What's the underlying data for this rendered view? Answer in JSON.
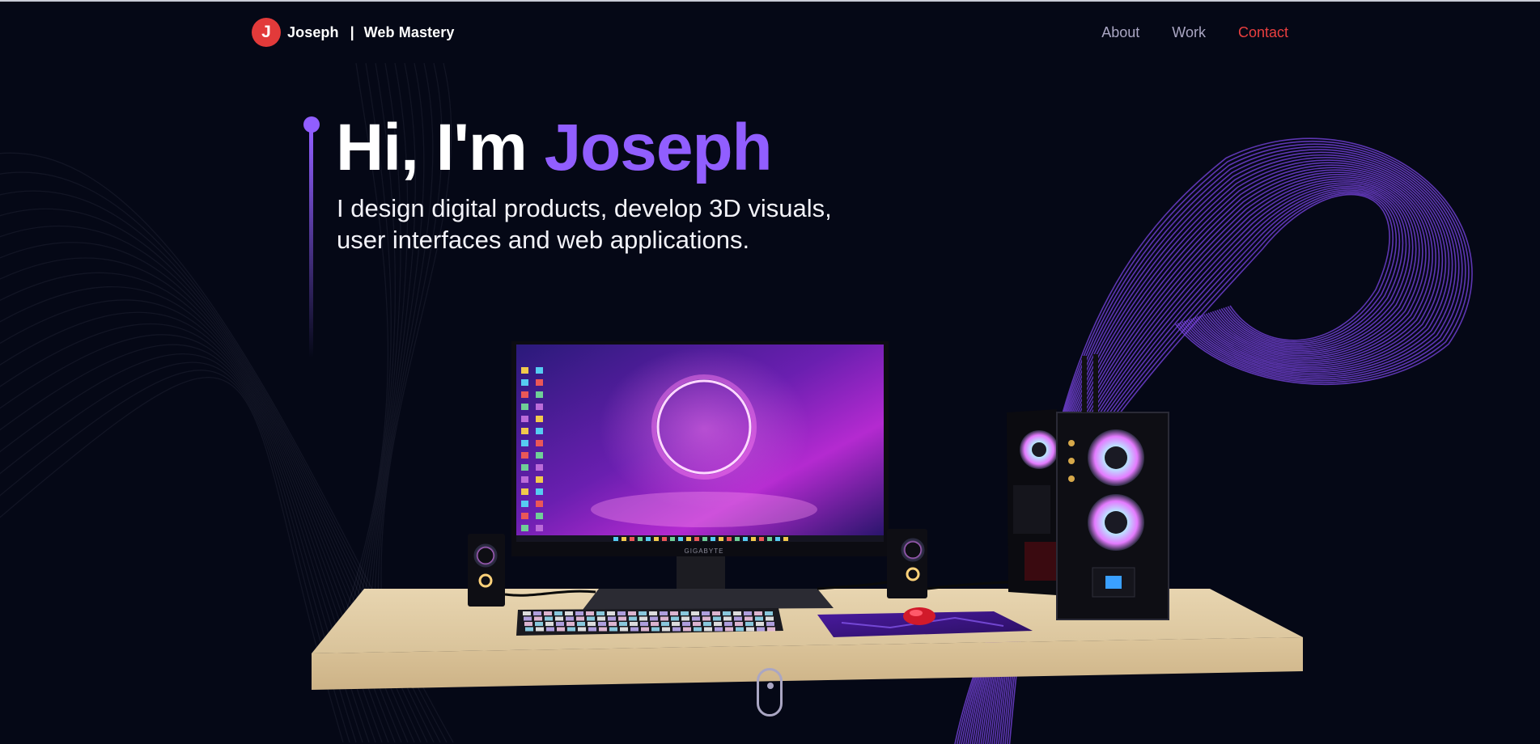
{
  "brand": {
    "initial": "J",
    "name": "Joseph",
    "separator": "|",
    "tagline": "Web Mastery"
  },
  "nav": {
    "items": [
      "About",
      "Work",
      "Contact"
    ],
    "active": "Contact"
  },
  "hero": {
    "greeting": "Hi, I'm",
    "name": "Joseph",
    "subtitle_line1": "I design digital products, develop 3D visuals,",
    "subtitle_line2": "user interfaces and web applications."
  },
  "scene": {
    "monitor_brand": "GIGABYTE"
  },
  "icons": [
    "logo-icon",
    "mouse-scroll-icon"
  ],
  "colors": {
    "background": "#050816",
    "accent": "#915eff",
    "brand": "#e23a3a",
    "nav_text": "#aaa6c3",
    "nav_active": "#ea3f3f"
  }
}
